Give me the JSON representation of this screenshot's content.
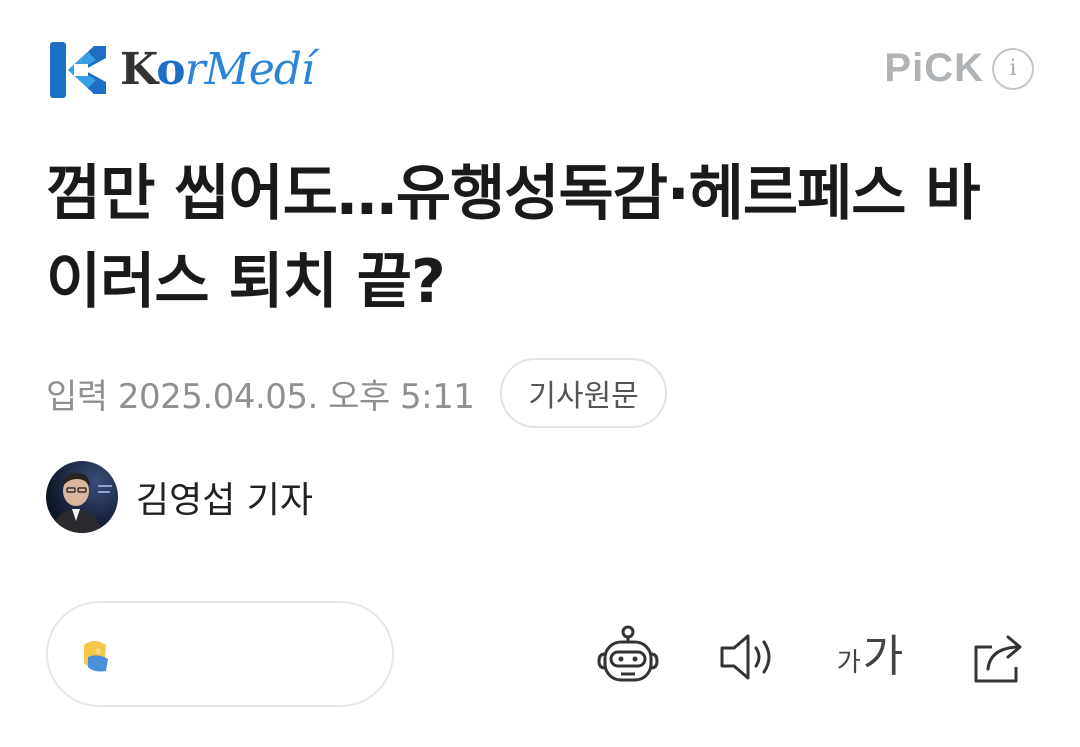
{
  "header": {
    "logo_text_k": "K",
    "logo_text_o": "o",
    "logo_text_rest": "rMedí",
    "pick_label": "PiCK",
    "info_icon": "i"
  },
  "article": {
    "title": "껌만 씹어도…유행성독감·헤르페스 바이러스 퇴치 끝?",
    "published": "입력 2025.04.05. 오후 5:11",
    "source_button": "기사원문",
    "reporter": "김영섭 기자"
  },
  "toolbar": {
    "font_size_small": "가",
    "font_size_large": "가",
    "icons": [
      "ai-summary-robot-icon",
      "text-to-speech-speaker-icon",
      "font-size-icon",
      "share-icon"
    ]
  },
  "colors": {
    "brand_blue": "#2b84d6",
    "muted_text": "#8e9093",
    "pick_gray": "#b0b3b6"
  }
}
